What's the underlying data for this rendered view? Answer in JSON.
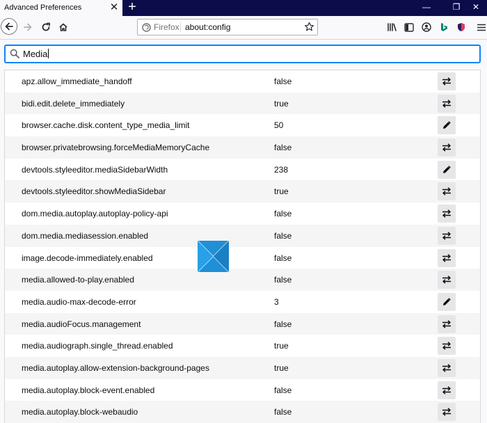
{
  "tab": {
    "title": "Advanced Preferences"
  },
  "window": {
    "new_tab": "+",
    "minimize": "—",
    "restore": "❐",
    "close": "✕"
  },
  "urlbar": {
    "identity_label": "Firefox",
    "url": "about:config"
  },
  "search": {
    "value": "Media"
  },
  "prefs": [
    {
      "name": "apz.allow_immediate_handoff",
      "value": "false",
      "action": "toggle-icon"
    },
    {
      "name": "bidi.edit.delete_immediately",
      "value": "true",
      "action": "toggle-icon"
    },
    {
      "name": "browser.cache.disk.content_type_media_limit",
      "value": "50",
      "action": "edit-icon"
    },
    {
      "name": "browser.privatebrowsing.forceMediaMemoryCache",
      "value": "false",
      "action": "toggle-icon"
    },
    {
      "name": "devtools.styleeditor.mediaSidebarWidth",
      "value": "238",
      "action": "edit-icon"
    },
    {
      "name": "devtools.styleeditor.showMediaSidebar",
      "value": "true",
      "action": "toggle-icon"
    },
    {
      "name": "dom.media.autoplay.autoplay-policy-api",
      "value": "false",
      "action": "toggle-icon"
    },
    {
      "name": "dom.media.mediasession.enabled",
      "value": "false",
      "action": "toggle-icon"
    },
    {
      "name": "image.decode-immediately.enabled",
      "value": "false",
      "action": "toggle-icon"
    },
    {
      "name": "media.allowed-to-play.enabled",
      "value": "false",
      "action": "toggle-icon"
    },
    {
      "name": "media.audio-max-decode-error",
      "value": "3",
      "action": "edit-icon"
    },
    {
      "name": "media.audioFocus.management",
      "value": "false",
      "action": "toggle-icon"
    },
    {
      "name": "media.audiograph.single_thread.enabled",
      "value": "true",
      "action": "toggle-icon"
    },
    {
      "name": "media.autoplay.allow-extension-background-pages",
      "value": "true",
      "action": "toggle-icon"
    },
    {
      "name": "media.autoplay.block-event.enabled",
      "value": "false",
      "action": "toggle-icon"
    },
    {
      "name": "media.autoplay.block-webaudio",
      "value": "false",
      "action": "toggle-icon"
    }
  ]
}
